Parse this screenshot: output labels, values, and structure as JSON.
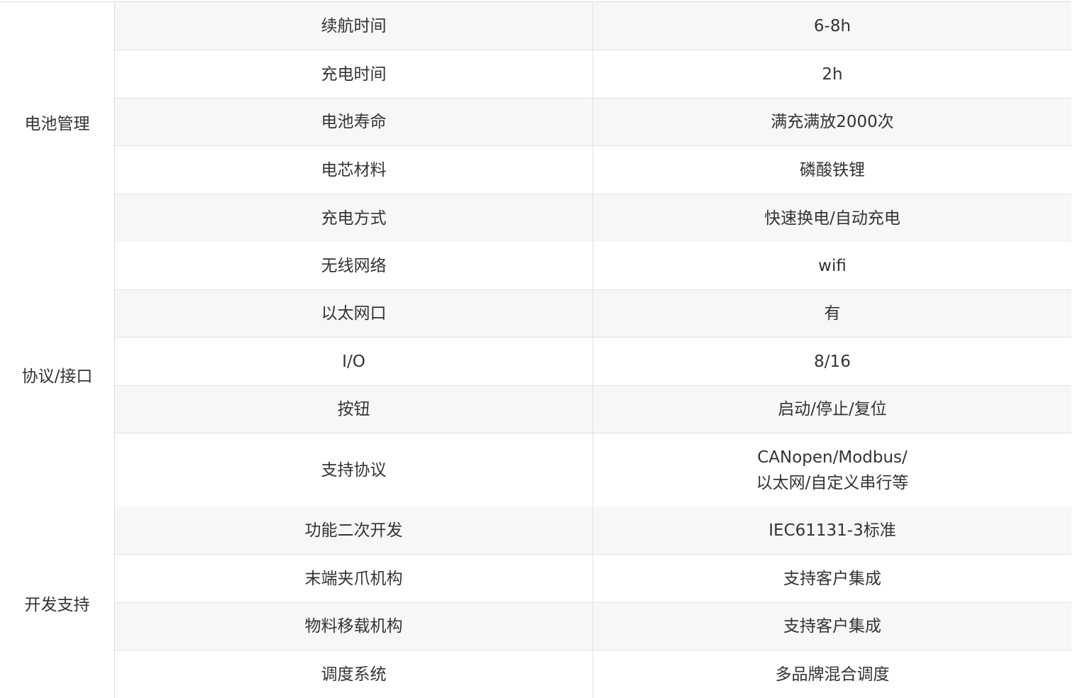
{
  "groups": [
    {
      "label": "电池管理",
      "rows": [
        {
          "name": "续航时间",
          "value": [
            "6-8h"
          ]
        },
        {
          "name": "充电时间",
          "value": [
            "2h"
          ]
        },
        {
          "name": "电池寿命",
          "value": [
            "满充满放2000次"
          ]
        },
        {
          "name": "电芯材料",
          "value": [
            "磷酸铁锂"
          ]
        },
        {
          "name": "充电方式",
          "value": [
            "快速换电/自动充电"
          ]
        }
      ]
    },
    {
      "label": "协议/接口",
      "rows": [
        {
          "name": "无线网络",
          "value": [
            "wifi"
          ]
        },
        {
          "name": "以太网口",
          "value": [
            "有"
          ]
        },
        {
          "name": "I/O",
          "value": [
            "8/16"
          ]
        },
        {
          "name": "按钮",
          "value": [
            "启动/停止/复位"
          ]
        },
        {
          "name": "支持协议",
          "value": [
            "CANopen/Modbus/",
            "以太网/自定义串行等"
          ]
        }
      ]
    },
    {
      "label": "开发支持",
      "rows": [
        {
          "name": "功能二次开发",
          "value": [
            "IEC61131-3标准"
          ]
        },
        {
          "name": "末端夹爪机构",
          "value": [
            "支持客户集成"
          ]
        },
        {
          "name": "物料移载机构",
          "value": [
            "支持客户集成"
          ]
        },
        {
          "name": "调度系统",
          "value": [
            "多品牌混合调度"
          ]
        }
      ]
    }
  ]
}
